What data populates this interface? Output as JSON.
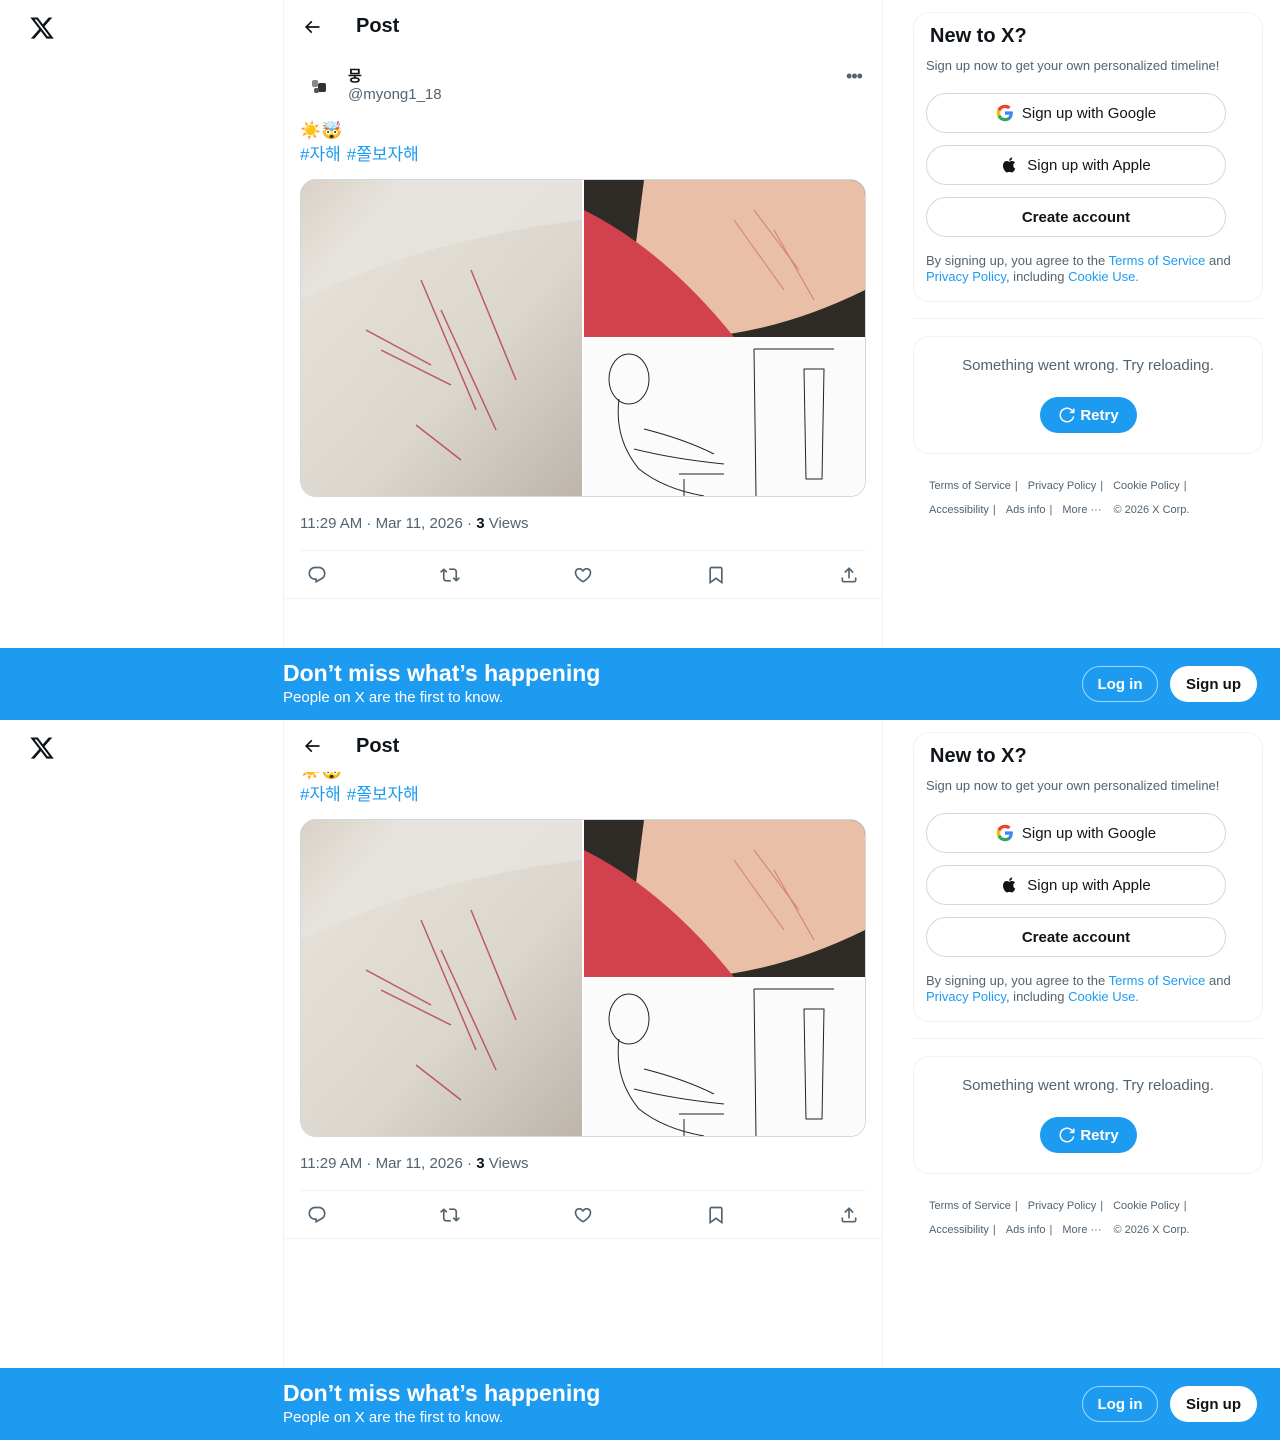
{
  "header": {
    "title": "Post"
  },
  "author": {
    "name": "뭉",
    "handle": "@myong1_18"
  },
  "tweet": {
    "emoji_line": "☀️🤯",
    "hashtags": [
      "#자해",
      "#쫄보자해"
    ],
    "time": "11:29 AM · Mar 11, 2026 · ",
    "views_count": "3",
    "views_label": " Views"
  },
  "signup": {
    "title": "New to X?",
    "subtitle": "Sign up now to get your own personalized timeline!",
    "google": "Sign up with Google",
    "apple": "Sign up with Apple",
    "create": "Create account",
    "terms_prefix": "By signing up, you agree to the ",
    "terms_link": "Terms of Service",
    "terms_and": " and ",
    "privacy_link": "Privacy Policy",
    "terms_including": ", including ",
    "cookie_link": "Cookie Use."
  },
  "error": {
    "message": "Something went wrong. Try reloading.",
    "retry": "Retry"
  },
  "footer": {
    "links": [
      "Terms of Service",
      "Privacy Policy",
      "Cookie Policy",
      "Accessibility",
      "Ads info",
      "More ···"
    ],
    "copyright": "© 2026 X Corp."
  },
  "banner": {
    "title": "Don’t miss what’s happening",
    "subtitle": "People on X are the first to know.",
    "login": "Log in",
    "signup": "Sign up"
  },
  "colors": {
    "accent": "#1d9bf0",
    "text": "#0f1419",
    "muted": "#536471"
  },
  "icons": [
    "x-logo-icon",
    "back-arrow-icon",
    "more-icon",
    "reply-icon",
    "repost-icon",
    "like-icon",
    "bookmark-icon",
    "share-icon",
    "google-icon",
    "apple-icon",
    "refresh-icon"
  ]
}
